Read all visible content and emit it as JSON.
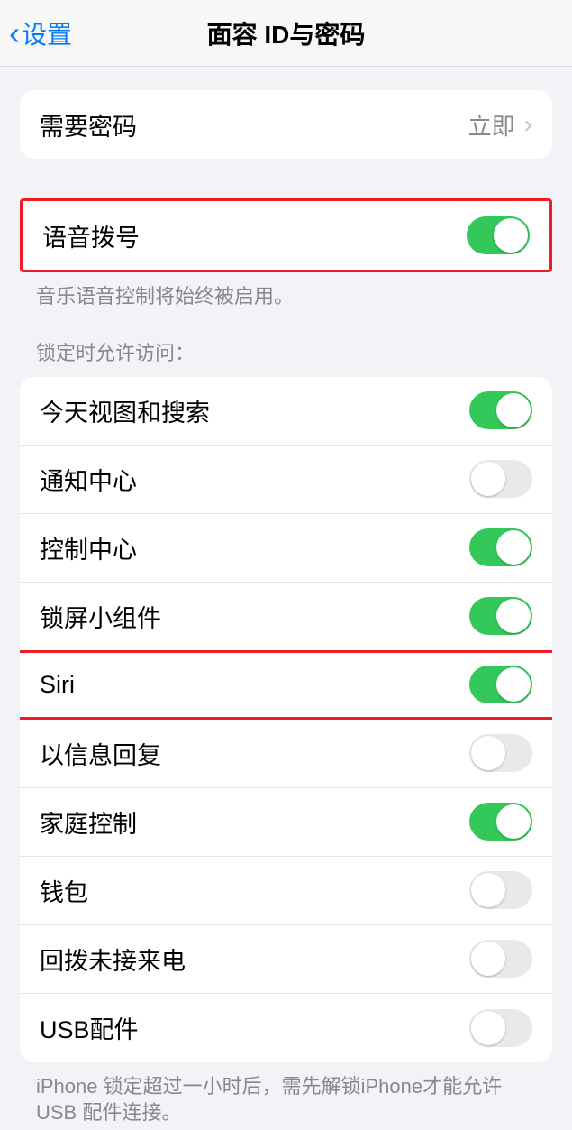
{
  "nav": {
    "back_label": "设置",
    "title": "面容 ID与密码"
  },
  "passcode_group": {
    "require_label": "需要密码",
    "require_value": "立即"
  },
  "voice_group": {
    "voice_dial_label": "语音拨号",
    "voice_dial_on": true,
    "footer": "音乐语音控制将始终被启用。"
  },
  "lock_access": {
    "header": "锁定时允许访问：",
    "items": [
      {
        "label": "今天视图和搜索",
        "on": true
      },
      {
        "label": "通知中心",
        "on": false
      },
      {
        "label": "控制中心",
        "on": true
      },
      {
        "label": "锁屏小组件",
        "on": true
      },
      {
        "label": "Siri",
        "on": true
      },
      {
        "label": "以信息回复",
        "on": false
      },
      {
        "label": "家庭控制",
        "on": true
      },
      {
        "label": "钱包",
        "on": false
      },
      {
        "label": "回拨未接来电",
        "on": false
      },
      {
        "label": "USB配件",
        "on": false
      }
    ],
    "footer": "iPhone 锁定超过一小时后，需先解锁iPhone才能允许USB 配件连接。"
  }
}
